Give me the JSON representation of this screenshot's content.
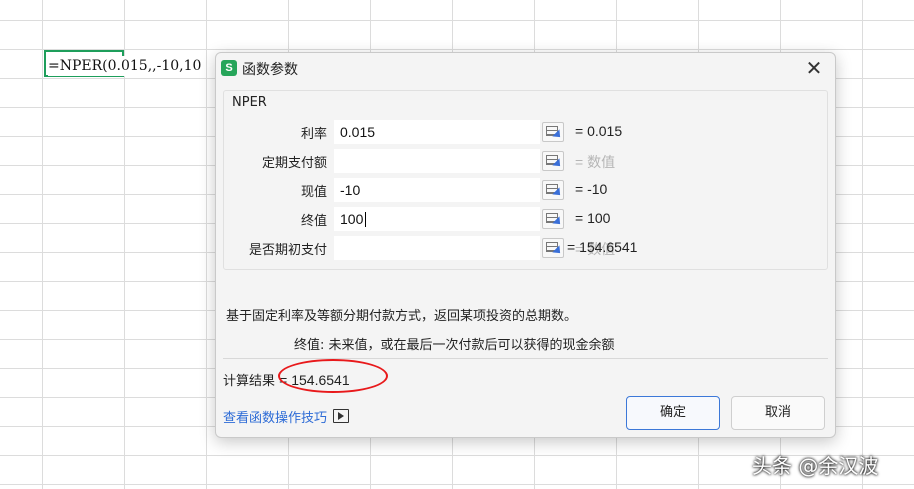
{
  "sheet": {
    "cell_formula": "=NPER(0.015,,-10,10"
  },
  "dialog": {
    "title": "函数参数",
    "app_icon": "wps-spreadsheet-icon",
    "app_icon_glyph": "S",
    "close_glyph": "✕",
    "function_name": "NPER",
    "args": [
      {
        "label": "利率",
        "value": "0.015",
        "result": "= 0.015",
        "result_is_placeholder": false
      },
      {
        "label": "定期支付额",
        "value": "",
        "result": "= 数值",
        "result_is_placeholder": true
      },
      {
        "label": "现值",
        "value": "-10",
        "result": "= -10",
        "result_is_placeholder": false
      },
      {
        "label": "终值",
        "value": "100",
        "result": "= 100",
        "result_is_placeholder": false
      },
      {
        "label": "是否期初支付",
        "value": "",
        "result": "= 数值",
        "result_is_placeholder": true
      }
    ],
    "formula_result": "= 154.6541",
    "description": "基于固定利率及等额分期付款方式，返回某项投资的总期数。",
    "param_description": "终值:  未来值，或在最后一次付款后可以获得的现金余额",
    "calc_result_label": "计算结果",
    "calc_result_value": "= 154.6541",
    "help_link": "查看函数操作技巧",
    "ok_label": "确定",
    "cancel_label": "取消",
    "annotation_color": "#e8191b"
  },
  "watermark": "头条 @余汉波"
}
